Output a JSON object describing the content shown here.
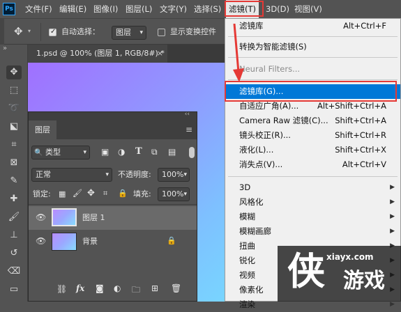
{
  "app": {
    "logo": "Ps"
  },
  "menubar": {
    "items": [
      "文件(F)",
      "编辑(E)",
      "图像(I)",
      "图层(L)",
      "文字(Y)",
      "选择(S)",
      "滤镜(T)",
      "3D(D)",
      "视图(V)"
    ]
  },
  "options_bar": {
    "auto_select_label": "自动选择：",
    "auto_select_checked": true,
    "auto_select_target": "图层",
    "show_transform_label": "显示变换控件",
    "show_transform_checked": false
  },
  "document": {
    "tab_title": "1.psd @ 100% (图层 1, RGB/8#) *",
    "close": "×",
    "collapse": "»"
  },
  "layers_panel": {
    "tab_label": "图层",
    "collapse": "‹‹",
    "filter_kind": "类型",
    "blend_mode": "正常",
    "opacity_label": "不透明度:",
    "opacity_value": "100%",
    "lock_label": "锁定:",
    "fill_label": "填充:",
    "fill_value": "100%",
    "layers": [
      {
        "name": "图层 1",
        "selected": true,
        "locked": false
      },
      {
        "name": "背景",
        "selected": false,
        "locked": true
      }
    ],
    "bottom_icons": [
      "link-icon",
      "fx-icon",
      "mask-icon",
      "adjustment-icon",
      "group-icon",
      "new-layer-icon",
      "trash-icon"
    ]
  },
  "filter_menu": {
    "items": [
      {
        "label": "滤镜库",
        "shortcut": "Alt+Ctrl+F"
      },
      {
        "label": "转换为智能滤镜(S)",
        "shortcut": ""
      },
      {
        "label": "Neural Filters...",
        "shortcut": "",
        "disabled": true
      },
      {
        "label": "滤镜库(G)...",
        "shortcut": "",
        "highlighted": true
      },
      {
        "label": "自适应广角(A)...",
        "shortcut": "Alt+Shift+Ctrl+A"
      },
      {
        "label": "Camera Raw 滤镜(C)...",
        "shortcut": "Shift+Ctrl+A"
      },
      {
        "label": "镜头校正(R)...",
        "shortcut": "Shift+Ctrl+R"
      },
      {
        "label": "液化(L)...",
        "shortcut": "Shift+Ctrl+X"
      },
      {
        "label": "消失点(V)...",
        "shortcut": "Alt+Ctrl+V"
      },
      {
        "label": "3D",
        "submenu": true
      },
      {
        "label": "风格化",
        "submenu": true
      },
      {
        "label": "模糊",
        "submenu": true
      },
      {
        "label": "模糊画廊",
        "submenu": true
      },
      {
        "label": "扭曲",
        "submenu": true
      },
      {
        "label": "锐化",
        "submenu": true
      },
      {
        "label": "视频",
        "submenu": true
      },
      {
        "label": "像素化",
        "submenu": true
      },
      {
        "label": "渲染",
        "submenu": true
      }
    ]
  },
  "watermark": {
    "url": "xiayx.com",
    "logo_char": "侠",
    "name": "游戏"
  },
  "colors": {
    "highlight": "#0078d7",
    "annotation_red": "#e53935",
    "ps_blue": "#31a8ff"
  }
}
